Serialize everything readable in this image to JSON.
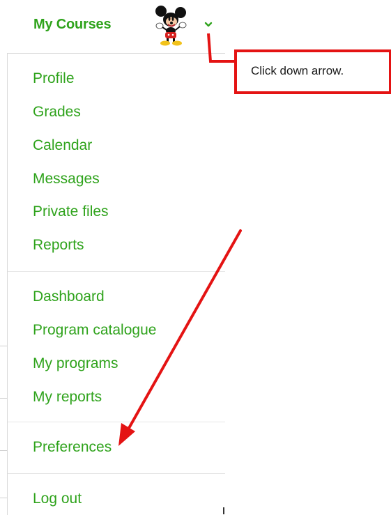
{
  "header": {
    "title": "My Courses",
    "avatar_icon": "mickey-mouse-avatar",
    "dropdown_icon": "chevron-down-icon"
  },
  "menu": {
    "groups": [
      [
        "Profile",
        "Grades",
        "Calendar",
        "Messages",
        "Private files",
        "Reports"
      ],
      [
        "Dashboard",
        "Program catalogue",
        "My programs",
        "My reports"
      ],
      [
        "Preferences"
      ],
      [
        "Log out"
      ]
    ]
  },
  "annotation": {
    "callout_text": "Click down arrow.",
    "accent_color": "#e41313"
  },
  "colors": {
    "link_green": "#2fa31c",
    "annotation_red": "#e41313"
  }
}
